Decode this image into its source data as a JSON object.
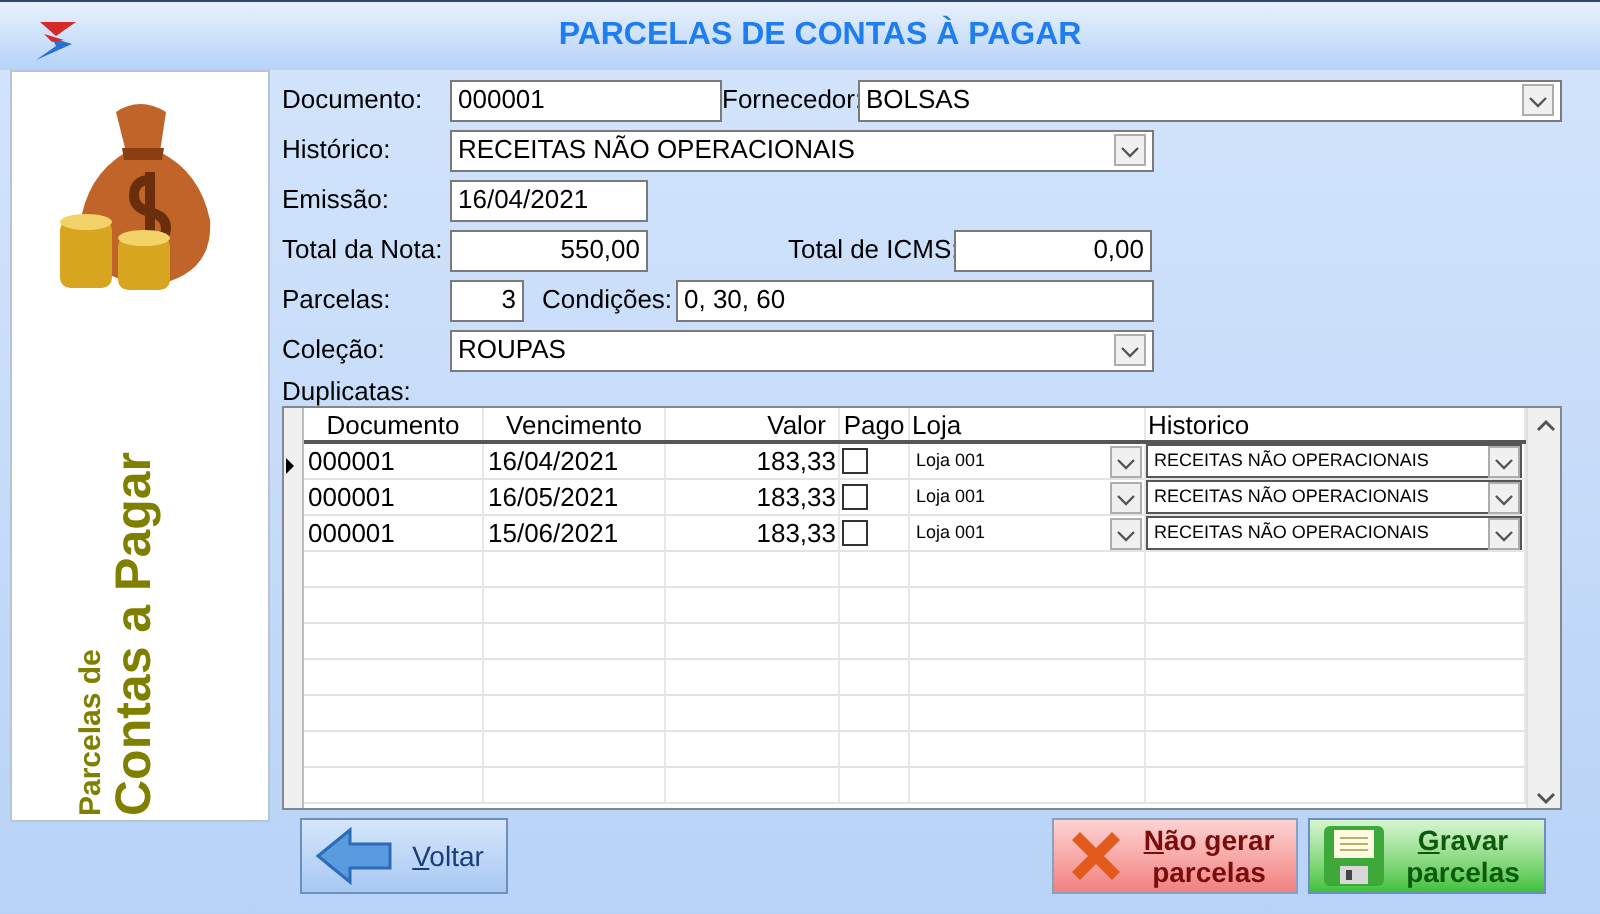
{
  "window": {
    "title": "PARCELAS DE CONTAS À PAGAR"
  },
  "side_panel": {
    "caption_small": "Parcelas de",
    "caption_large": "Contas a Pagar"
  },
  "form": {
    "documento": {
      "label": "Documento:",
      "value": "000001"
    },
    "fornecedor": {
      "label": "Fornecedor:",
      "value": "BOLSAS"
    },
    "historico": {
      "label": "Histórico:",
      "value": "RECEITAS NÃO OPERACIONAIS"
    },
    "emissao": {
      "label": "Emissão:",
      "value": "16/04/2021"
    },
    "total_nota": {
      "label": "Total da Nota:",
      "value": "550,00"
    },
    "total_icms": {
      "label": "Total de ICMS:",
      "value": "0,00"
    },
    "parcelas": {
      "label": "Parcelas:",
      "value": "3"
    },
    "condicoes": {
      "label": "Condições:",
      "value": "0, 30, 60"
    },
    "colecao": {
      "label": "Coleção:",
      "value": "ROUPAS"
    }
  },
  "duplicatas": {
    "label": "Duplicatas:",
    "columns": [
      "Documento",
      "Vencimento",
      "Valor",
      "Pago",
      "Loja",
      "Historico"
    ],
    "rows": [
      {
        "selected": true,
        "documento": "000001",
        "vencimento": "16/04/2021",
        "valor": "183,33",
        "pago": false,
        "loja": "Loja 001",
        "historico": "RECEITAS NÃO OPERACIONAIS"
      },
      {
        "selected": false,
        "documento": "000001",
        "vencimento": "16/05/2021",
        "valor": "183,33",
        "pago": false,
        "loja": "Loja 001",
        "historico": "RECEITAS NÃO OPERACIONAIS"
      },
      {
        "selected": false,
        "documento": "000001",
        "vencimento": "15/06/2021",
        "valor": "183,33",
        "pago": false,
        "loja": "Loja 001",
        "historico": "RECEITAS NÃO OPERACIONAIS"
      }
    ]
  },
  "buttons": [
    {
      "kind": "back",
      "lines": [
        "Voltar"
      ]
    },
    {
      "kind": "cancel",
      "lines": [
        "Não gerar",
        "parcelas"
      ]
    },
    {
      "kind": "save",
      "lines": [
        "Gravar",
        "parcelas"
      ]
    }
  ]
}
